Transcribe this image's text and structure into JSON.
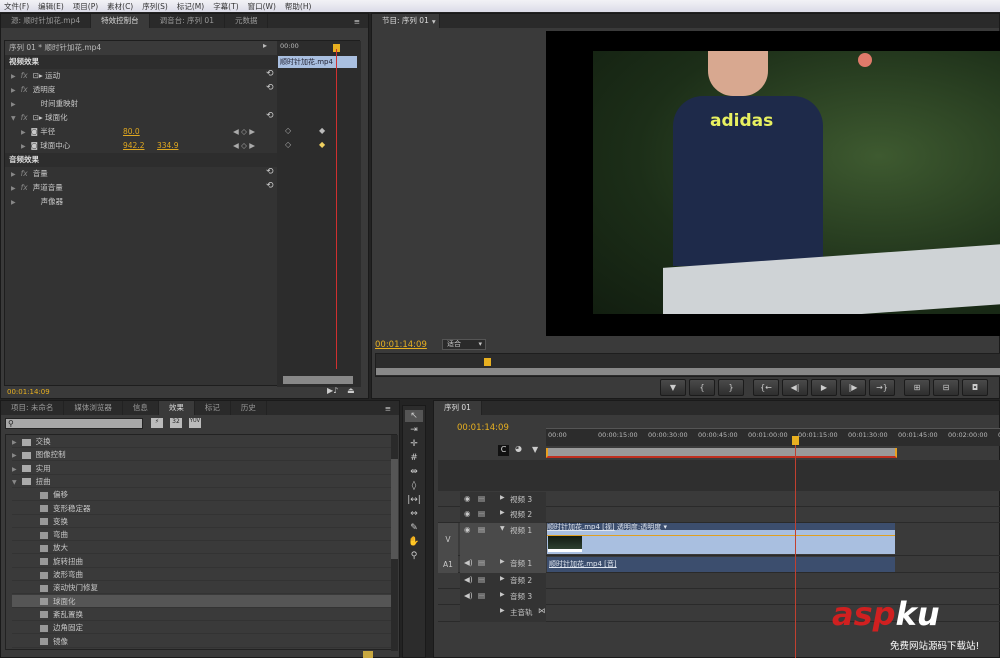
{
  "menu": [
    "文件(F)",
    "编辑(E)",
    "项目(P)",
    "素材(C)",
    "序列(S)",
    "标记(M)",
    "字幕(T)",
    "窗口(W)",
    "帮助(H)"
  ],
  "source_panel": {
    "tabs": [
      "源: 顺时针加花.mp4",
      "特效控制台",
      "调音台: 序列 01",
      "元数据"
    ],
    "active_tab": 1,
    "header": "序列 01 * 顺时针加花.mp4",
    "mini_time": "00:00",
    "clip_label": "顺时针加花.mp4",
    "video_effects_label": "视频效果",
    "audio_effects_label": "音频效果",
    "effects": [
      {
        "name": "运动",
        "fx": true,
        "expanded": false
      },
      {
        "name": "透明度",
        "fx": true,
        "expanded": false
      },
      {
        "name": "时间重映射",
        "fx": false,
        "expanded": false
      },
      {
        "name": "球面化",
        "fx": true,
        "expanded": true
      }
    ],
    "params": [
      {
        "name": "半径",
        "values": [
          "80.0"
        ]
      },
      {
        "name": "球面中心",
        "values": [
          "942.2",
          "334.9"
        ]
      }
    ],
    "audio_effects": [
      {
        "name": "音量",
        "fx": true
      },
      {
        "name": "声道音量",
        "fx": true
      },
      {
        "name": "声像器",
        "fx": false
      }
    ],
    "timecode": "00:01:14:09"
  },
  "program": {
    "tab": "节目: 序列 01",
    "timecode": "00:01:14:09",
    "zoom": "适合",
    "shirt_logo": "adidas",
    "controls": [
      "marker",
      "mark-in",
      "mark-out",
      "go-to-in",
      "step-back",
      "play",
      "step-forward",
      "go-to-out",
      "lift",
      "extract",
      "export-frame"
    ]
  },
  "effects_panel": {
    "tabs": [
      "项目: 未命名",
      "媒体浏览器",
      "信息",
      "效果",
      "标记",
      "历史"
    ],
    "active_tab": 3,
    "search_placeholder": "",
    "filter_icons": [
      "加速",
      "32",
      "YUV"
    ],
    "folders": [
      "交换",
      "图像控制",
      "实用",
      "扭曲"
    ],
    "items": [
      "偏移",
      "变形稳定器",
      "变换",
      "弯曲",
      "放大",
      "旋转扭曲",
      "波形弯曲",
      "滚动快门修复",
      "球面化",
      "紊乱置换",
      "边角固定",
      "镜像"
    ],
    "selected": "球面化"
  },
  "timeline": {
    "tab": "序列 01",
    "timecode": "00:01:14:09",
    "ruler": [
      "00:00",
      "00:00:15:00",
      "00:00:30:00",
      "00:00:45:00",
      "00:01:00:00",
      "00:01:15:00",
      "00:01:30:00",
      "00:01:45:00",
      "00:02:00:00",
      "00:02:1"
    ],
    "tracks": [
      {
        "name": "视频 3"
      },
      {
        "name": "视频 2"
      },
      {
        "name": "视频 1",
        "target": "V"
      },
      {
        "name": "音频 1",
        "target": "A1"
      },
      {
        "name": "音频 2"
      },
      {
        "name": "音频 3"
      },
      {
        "name": "主音轨"
      }
    ],
    "video_clip": "顺时针加花.mp4 [视]",
    "video_clip_fx": "透明度:透明度 ▾",
    "audio_clip": "顺时针加花.mp4 [音]"
  },
  "watermark": {
    "brand_red": "asp",
    "brand_white": "ku",
    ".com": ".com",
    "tagline": "免费网站源码下载站!"
  },
  "colors": {
    "accent_timecode": "#e8b020",
    "playhead": "#d03030",
    "clip": "#3c4e6e",
    "selected_clip": "#a9bfe0"
  }
}
